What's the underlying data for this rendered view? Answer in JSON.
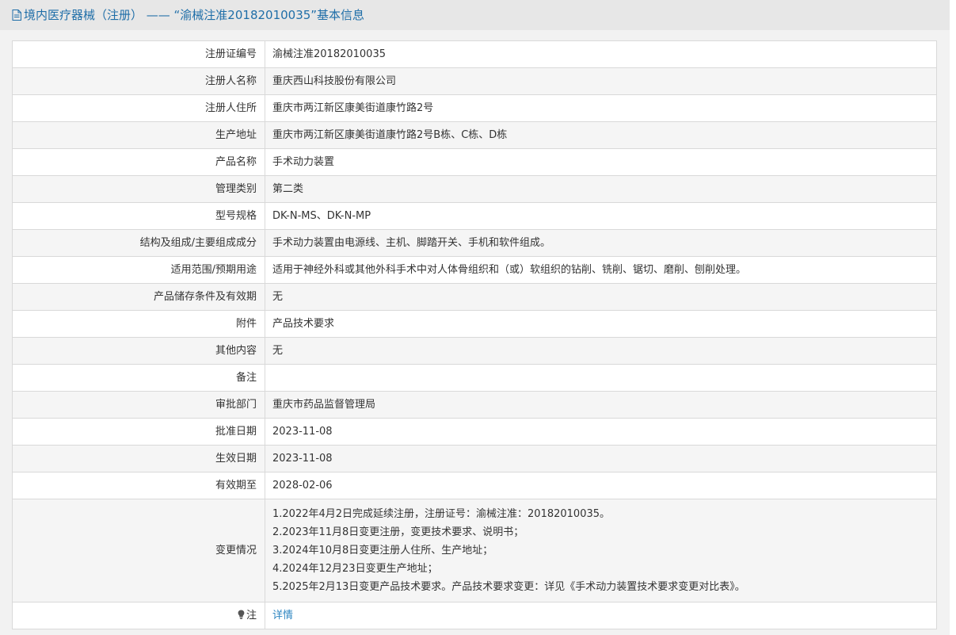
{
  "page": {
    "title": "境内医疗器械（注册） —— “渝械注准20182010035”基本信息"
  },
  "fields": {
    "reg_no": {
      "label": "注册证编号",
      "value": "渝械注准20182010035"
    },
    "registrant_name": {
      "label": "注册人名称",
      "value": "重庆西山科技股份有限公司"
    },
    "registrant_address": {
      "label": "注册人住所",
      "value": "重庆市两江新区康美街道康竹路2号"
    },
    "production_address": {
      "label": "生产地址",
      "value": "重庆市两江新区康美街道康竹路2号B栋、C栋、D栋"
    },
    "product_name": {
      "label": "产品名称",
      "value": "手术动力装置"
    },
    "category": {
      "label": "管理类别",
      "value": "第二类"
    },
    "model_spec": {
      "label": "型号规格",
      "value": "DK-N-MS、DK-N-MP"
    },
    "structure": {
      "label": "结构及组成/主要组成成分",
      "value": "手术动力装置由电源线、主机、脚踏开关、手机和软件组成。"
    },
    "scope": {
      "label": "适用范围/预期用途",
      "value": "适用于神经外科或其他外科手术中对人体骨组织和（或）软组织的钻削、铣削、锯切、磨削、刨削处理。"
    },
    "storage": {
      "label": "产品储存条件及有效期",
      "value": "无"
    },
    "attachment": {
      "label": "附件",
      "value": "产品技术要求"
    },
    "other": {
      "label": "其他内容",
      "value": "无"
    },
    "remarks": {
      "label": "备注",
      "value": ""
    },
    "approval_dept": {
      "label": "审批部门",
      "value": "重庆市药品监督管理局"
    },
    "approval_date": {
      "label": "批准日期",
      "value": "2023-11-08"
    },
    "effective_date": {
      "label": "生效日期",
      "value": "2023-11-08"
    },
    "expiry_date": {
      "label": "有效期至",
      "value": "2028-02-06"
    }
  },
  "changes": {
    "label": "变更情况",
    "lines": [
      "1.2022年4月2日完成延续注册，注册证号：渝械注准：20182010035。",
      "2.2023年11月8日变更注册，变更技术要求、说明书；",
      "3.2024年10月8日变更注册人住所、生产地址；",
      "4.2024年12月23日变更生产地址；",
      "5.2025年2月13日变更产品技术要求。产品技术要求变更：详见《手术动力装置技术要求变更对比表》。"
    ]
  },
  "note": {
    "label": "注",
    "link_text": "详情",
    "icon": "lightbulb-icon"
  },
  "colors": {
    "title": "#1f6ea8",
    "link": "#2e86c1",
    "border": "#d9d9d9",
    "stripe": "#f5f5f5"
  }
}
